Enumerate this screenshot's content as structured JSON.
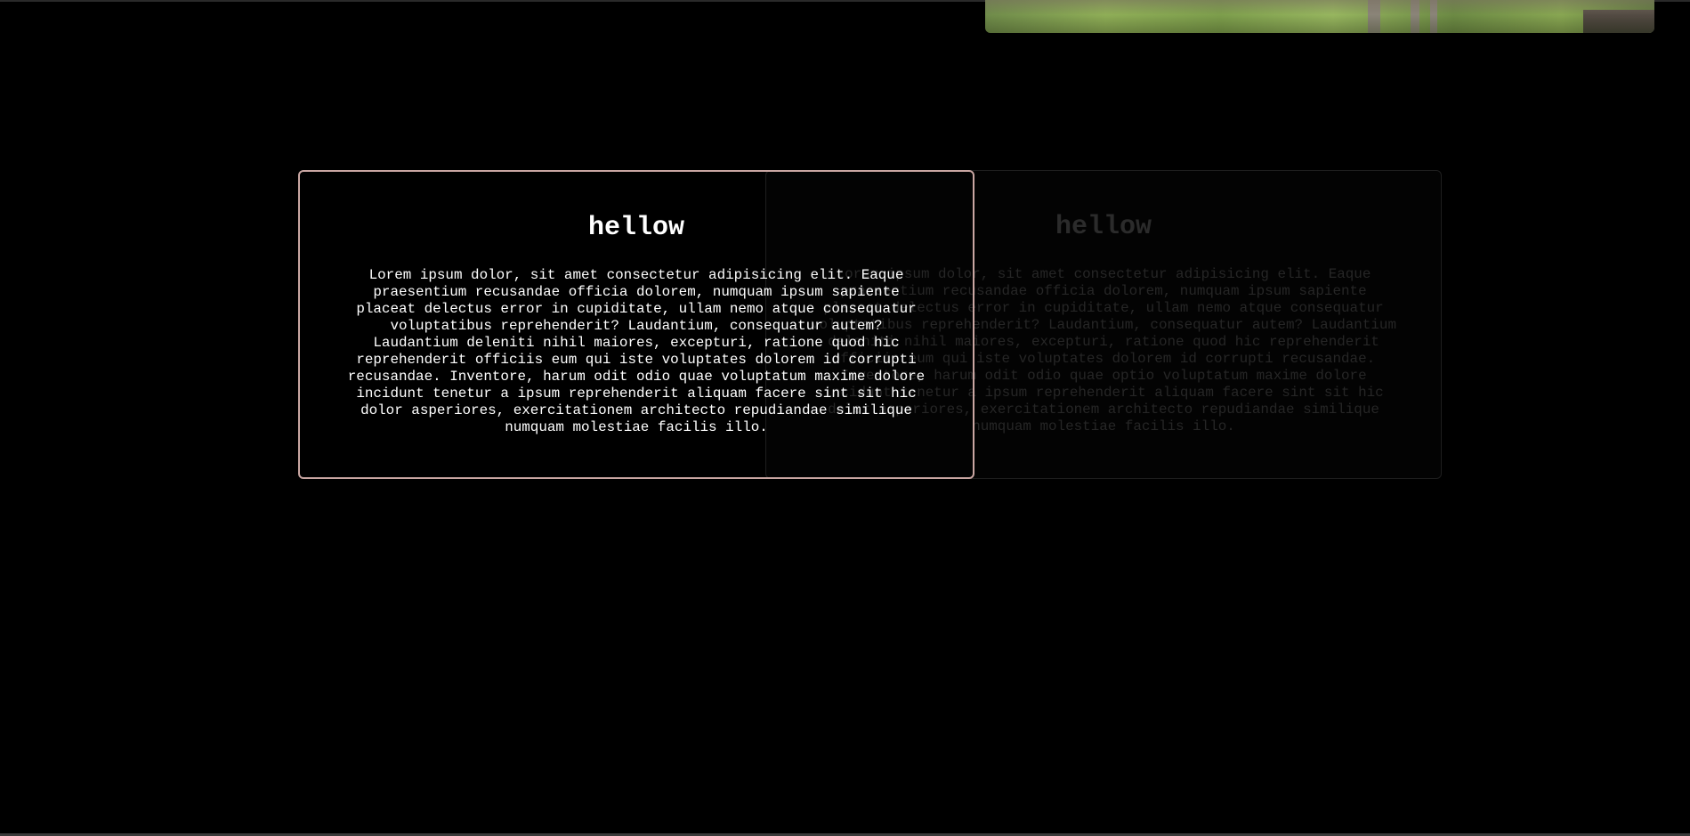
{
  "cards": [
    {
      "title": "hellow",
      "body": "Lorem ipsum dolor, sit amet consectetur adipisicing elit. Eaque praesentium recusandae officia dolorem, numquam ipsum sapiente placeat delectus error in cupiditate, ullam nemo atque consequatur voluptatibus reprehenderit? Laudantium, consequatur autem? Laudantium deleniti nihil maiores, excepturi, ratione quod hic reprehenderit officiis eum qui iste voluptates dolorem id corrupti recusandae. Inventore, harum odit odio quae voluptatum maxime dolore incidunt tenetur a ipsum reprehenderit aliquam facere sint sit hic dolor asperiores, exercitationem architecto repudiandae similique numquam molestiae facilis illo."
    },
    {
      "title": "hellow",
      "body": "Lorem ipsum dolor, sit amet consectetur adipisicing elit. Eaque praesentium recusandae officia dolorem, numquam ipsum sapiente placeat delectus error in cupiditate, ullam nemo atque consequatur voluptatibus reprehenderit? Laudantium, consequatur autem? Laudantium deleniti nihil maiores, excepturi, ratione quod hic reprehenderit officiis eum qui iste voluptates dolorem id corrupti recusandae. Inventore, harum odit odio quae optio voluptatum maxime dolore incidunt tenetur a ipsum reprehenderit aliquam facere sint sit hic dolor asperiores, exercitationem architecto repudiandae similique numquam molestiae facilis illo."
    }
  ],
  "colors": {
    "page_background": "#000000",
    "active_card_border": "#c9a6a2",
    "active_card_text": "#ffffff",
    "faded_card_text": "#262626"
  }
}
